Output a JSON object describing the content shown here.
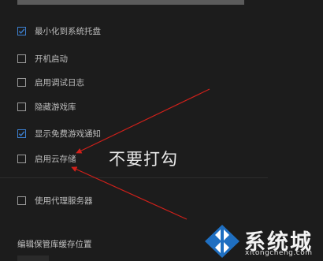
{
  "settings": {
    "options": [
      {
        "label": "最小化到系统托盘",
        "checked": true
      },
      {
        "label": "开机启动",
        "checked": false
      },
      {
        "label": "启用调试日志",
        "checked": false
      },
      {
        "label": "隐藏游戏库",
        "checked": false
      },
      {
        "label": "显示免费游戏通知",
        "checked": true
      },
      {
        "label": "启用云存储",
        "checked": false
      },
      {
        "label": "使用代理服务器",
        "checked": false
      }
    ],
    "section_title": "编辑保管库缓存位置"
  },
  "annotation": {
    "text": "不要打勾",
    "color": "#d0201a"
  },
  "watermark": {
    "brand": "系统城",
    "domain": "xitongcheng.com"
  },
  "colors": {
    "background": "#1c1c1c",
    "accent": "#3c7fcf"
  }
}
